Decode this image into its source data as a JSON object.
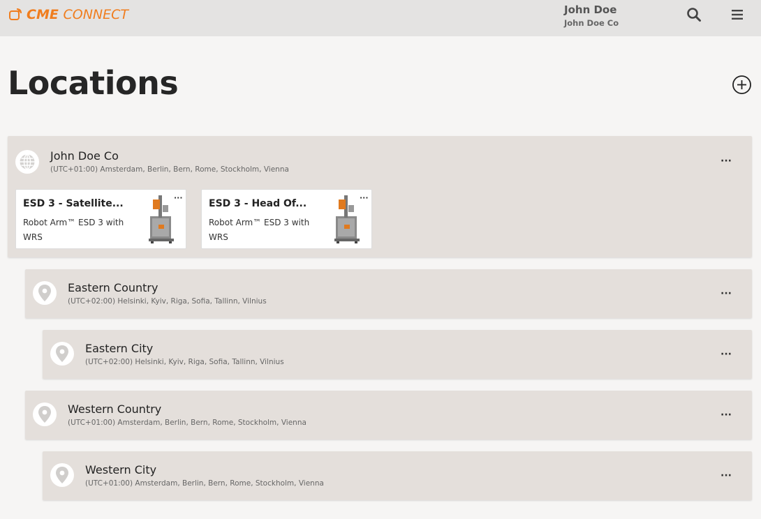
{
  "app": {
    "logo_bold": "CME",
    "logo_thin": "CONNECT"
  },
  "user": {
    "name": "John Doe",
    "company": "John Doe Co"
  },
  "page": {
    "title": "Locations"
  },
  "root": {
    "name": "John Doe Co",
    "tz": "(UTC+01:00) Amsterdam, Berlin, Bern, Rome, Stockholm, Vienna",
    "cards": [
      {
        "title": "ESD 3 - Satellite...",
        "sub": "Robot Arm™ ESD 3 with WRS"
      },
      {
        "title": "ESD 3 - Head Of...",
        "sub": "Robot Arm™ ESD 3 with WRS"
      }
    ]
  },
  "locations": [
    {
      "name": "Eastern Country",
      "tz": "(UTC+02:00) Helsinki, Kyiv, Riga, Sofia, Tallinn, Vilnius"
    },
    {
      "name": "Eastern City",
      "tz": "(UTC+02:00) Helsinki, Kyiv, Riga, Sofia, Tallinn, Vilnius"
    },
    {
      "name": "Western Country",
      "tz": "(UTC+01:00) Amsterdam, Berlin, Bern, Rome, Stockholm, Vienna"
    },
    {
      "name": "Western City",
      "tz": "(UTC+01:00) Amsterdam, Berlin, Bern, Rome, Stockholm, Vienna"
    }
  ],
  "icons": {
    "logo": "cme-logo-icon",
    "search": "search-icon",
    "menu": "hamburger-menu-icon",
    "add": "plus-circle-icon",
    "globe": "globe-icon",
    "pin": "map-pin-icon",
    "more": "more-dots-icon"
  },
  "colors": {
    "brand": "#f07d1e",
    "topbar": "#e4e3e2",
    "row": "#e4dfdb"
  },
  "more_label": "···"
}
